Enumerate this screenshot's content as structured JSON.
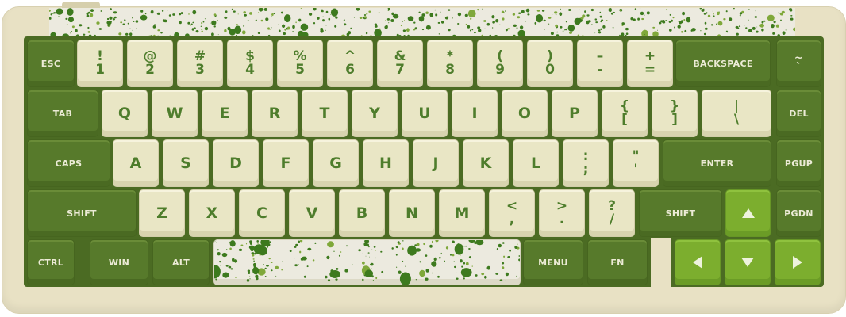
{
  "colors": {
    "case": "#e8e1c4",
    "plate": "#4b6b23",
    "alpha_key": "#e9e6c5",
    "alpha_legend": "#4e7d2c",
    "modifier_key": "#577a2b",
    "modifier_legend": "#ecebd6",
    "arrow_key": "#7cae2e",
    "splatter": "#3d7a1e"
  },
  "rows": {
    "number": [
      {
        "id": "esc",
        "type": "mod",
        "label": "ESC"
      },
      {
        "id": "1",
        "type": "alpha",
        "top": "!",
        "bottom": "1"
      },
      {
        "id": "2",
        "type": "alpha",
        "top": "@",
        "bottom": "2"
      },
      {
        "id": "3",
        "type": "alpha",
        "top": "#",
        "bottom": "3"
      },
      {
        "id": "4",
        "type": "alpha",
        "top": "$",
        "bottom": "4"
      },
      {
        "id": "5",
        "type": "alpha",
        "top": "%",
        "bottom": "5"
      },
      {
        "id": "6",
        "type": "alpha",
        "top": "^",
        "bottom": "6"
      },
      {
        "id": "7",
        "type": "alpha",
        "top": "&",
        "bottom": "7"
      },
      {
        "id": "8",
        "type": "alpha",
        "top": "*",
        "bottom": "8"
      },
      {
        "id": "9",
        "type": "alpha",
        "top": "(",
        "bottom": "9"
      },
      {
        "id": "0",
        "type": "alpha",
        "top": ")",
        "bottom": "0"
      },
      {
        "id": "minus",
        "type": "alpha",
        "top": "–",
        "bottom": "-"
      },
      {
        "id": "equal",
        "type": "alpha",
        "top": "+",
        "bottom": "="
      },
      {
        "id": "backspace",
        "type": "mod",
        "label": "BACKSPACE"
      },
      {
        "id": "grave",
        "type": "mod",
        "top": "~",
        "bottom": "`"
      }
    ],
    "top": [
      {
        "id": "tab",
        "type": "mod",
        "label": "TAB"
      },
      {
        "id": "q",
        "type": "alpha",
        "label": "Q"
      },
      {
        "id": "w",
        "type": "alpha",
        "label": "W"
      },
      {
        "id": "e",
        "type": "alpha",
        "label": "E"
      },
      {
        "id": "r",
        "type": "alpha",
        "label": "R"
      },
      {
        "id": "t",
        "type": "alpha",
        "label": "T"
      },
      {
        "id": "y",
        "type": "alpha",
        "label": "Y"
      },
      {
        "id": "u",
        "type": "alpha",
        "label": "U"
      },
      {
        "id": "i",
        "type": "alpha",
        "label": "I"
      },
      {
        "id": "o",
        "type": "alpha",
        "label": "O"
      },
      {
        "id": "p",
        "type": "alpha",
        "label": "P"
      },
      {
        "id": "lbracket",
        "type": "alpha",
        "top": "{",
        "bottom": "["
      },
      {
        "id": "rbracket",
        "type": "alpha",
        "top": "}",
        "bottom": "]"
      },
      {
        "id": "backslash",
        "type": "alpha",
        "top": "|",
        "bottom": "\\"
      },
      {
        "id": "del",
        "type": "mod",
        "label": "DEL"
      }
    ],
    "home": [
      {
        "id": "caps",
        "type": "mod",
        "label": "CAPS"
      },
      {
        "id": "a",
        "type": "alpha",
        "label": "A"
      },
      {
        "id": "s",
        "type": "alpha",
        "label": "S"
      },
      {
        "id": "d",
        "type": "alpha",
        "label": "D"
      },
      {
        "id": "f",
        "type": "alpha",
        "label": "F"
      },
      {
        "id": "g",
        "type": "alpha",
        "label": "G"
      },
      {
        "id": "h",
        "type": "alpha",
        "label": "H"
      },
      {
        "id": "j",
        "type": "alpha",
        "label": "J"
      },
      {
        "id": "k",
        "type": "alpha",
        "label": "K"
      },
      {
        "id": "l",
        "type": "alpha",
        "label": "L"
      },
      {
        "id": "semicolon",
        "type": "alpha",
        "top": ":",
        "bottom": ";"
      },
      {
        "id": "quote",
        "type": "alpha",
        "top": "\"",
        "bottom": "'"
      },
      {
        "id": "enter",
        "type": "mod",
        "label": "ENTER"
      },
      {
        "id": "pgup",
        "type": "mod",
        "label": "PGUP"
      }
    ],
    "bottom": [
      {
        "id": "lshift",
        "type": "mod",
        "label": "SHIFT"
      },
      {
        "id": "z",
        "type": "alpha",
        "label": "Z"
      },
      {
        "id": "x",
        "type": "alpha",
        "label": "X"
      },
      {
        "id": "c",
        "type": "alpha",
        "label": "C"
      },
      {
        "id": "v",
        "type": "alpha",
        "label": "V"
      },
      {
        "id": "b",
        "type": "alpha",
        "label": "B"
      },
      {
        "id": "n",
        "type": "alpha",
        "label": "N"
      },
      {
        "id": "m",
        "type": "alpha",
        "label": "M"
      },
      {
        "id": "comma",
        "type": "alpha",
        "top": "<",
        "bottom": ","
      },
      {
        "id": "period",
        "type": "alpha",
        "top": ">",
        "bottom": "."
      },
      {
        "id": "slash",
        "type": "alpha",
        "top": "?",
        "bottom": "/"
      },
      {
        "id": "rshift",
        "type": "mod",
        "label": "SHIFT"
      },
      {
        "id": "up",
        "type": "arrow",
        "icon": "arrow-up-icon"
      },
      {
        "id": "pgdn",
        "type": "mod",
        "label": "PGDN"
      }
    ],
    "space": [
      {
        "id": "ctrl",
        "type": "mod",
        "label": "CTRL"
      },
      {
        "id": "win",
        "type": "mod",
        "label": "WIN"
      },
      {
        "id": "alt",
        "type": "mod",
        "label": "ALT"
      },
      {
        "id": "spacebar",
        "type": "space"
      },
      {
        "id": "menu",
        "type": "mod",
        "label": "MENU"
      },
      {
        "id": "fn",
        "type": "mod",
        "label": "FN"
      },
      {
        "id": "left",
        "type": "arrow",
        "icon": "arrow-left-icon"
      },
      {
        "id": "down",
        "type": "arrow",
        "icon": "arrow-down-icon"
      },
      {
        "id": "right",
        "type": "arrow",
        "icon": "arrow-right-icon"
      }
    ]
  }
}
